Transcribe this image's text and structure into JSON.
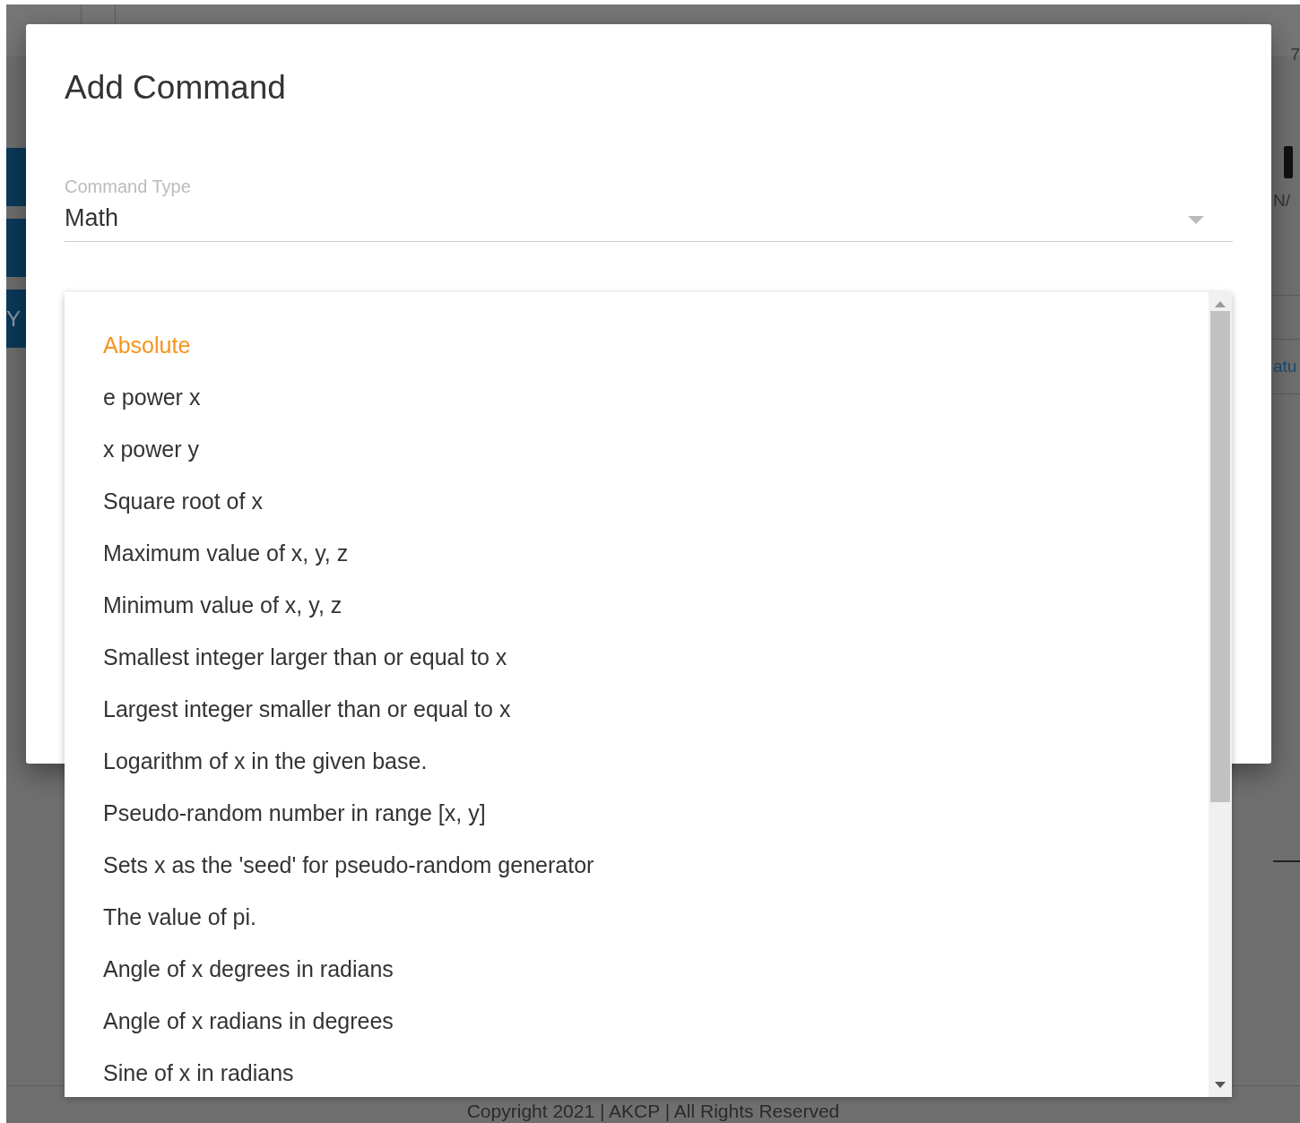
{
  "background": {
    "left_tab_text": "Y",
    "right_texts": [
      "7",
      "N/",
      "atu"
    ],
    "footer": "Copyright 2021 | AKCP | All Rights Reserved"
  },
  "dialog": {
    "title": "Add Command",
    "field": {
      "label": "Command Type",
      "value": "Math"
    }
  },
  "menu": {
    "items": [
      {
        "label": "Absolute",
        "selected": true
      },
      {
        "label": "e power x",
        "selected": false
      },
      {
        "label": "x power y",
        "selected": false
      },
      {
        "label": "Square root of x",
        "selected": false
      },
      {
        "label": "Maximum value of x, y, z",
        "selected": false
      },
      {
        "label": "Minimum value of x, y, z",
        "selected": false
      },
      {
        "label": "Smallest integer larger than or equal to x",
        "selected": false
      },
      {
        "label": "Largest integer smaller than or equal to x",
        "selected": false
      },
      {
        "label": "Logarithm of x in the given base.",
        "selected": false
      },
      {
        "label": "Pseudo-random number in range [x, y]",
        "selected": false
      },
      {
        "label": "Sets x as the 'seed' for pseudo-random generator",
        "selected": false
      },
      {
        "label": "The value of pi.",
        "selected": false
      },
      {
        "label": "Angle of x degrees in radians",
        "selected": false
      },
      {
        "label": "Angle of x radians in degrees",
        "selected": false
      },
      {
        "label": "Sine of x in radians",
        "selected": false
      }
    ]
  }
}
